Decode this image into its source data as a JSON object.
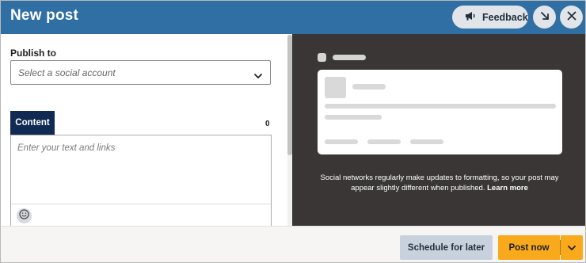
{
  "header": {
    "title": "New post",
    "feedback_label": "Feedback",
    "icons": {
      "feedback": "megaphone-icon",
      "minimize": "arrow-down-right-icon",
      "close": "close-icon"
    }
  },
  "compose": {
    "publish_label": "Publish to",
    "account_placeholder": "Select a social account",
    "content_tab": "Content",
    "char_count": "0",
    "content_placeholder": "Enter your text and links",
    "emoji_icon": "smiley-icon"
  },
  "preview": {
    "note": "Social networks regularly make updates to formatting, so your post may appear slightly different when published.",
    "learn_more": "Learn more"
  },
  "footer": {
    "schedule_label": "Schedule for later",
    "post_label": "Post now"
  },
  "colors": {
    "header_bg": "#2f6fa3",
    "tab_bg": "#102a54",
    "preview_bg": "#3a3636",
    "post_button": "#f9a91c",
    "schedule_button": "#c8d2dd"
  }
}
